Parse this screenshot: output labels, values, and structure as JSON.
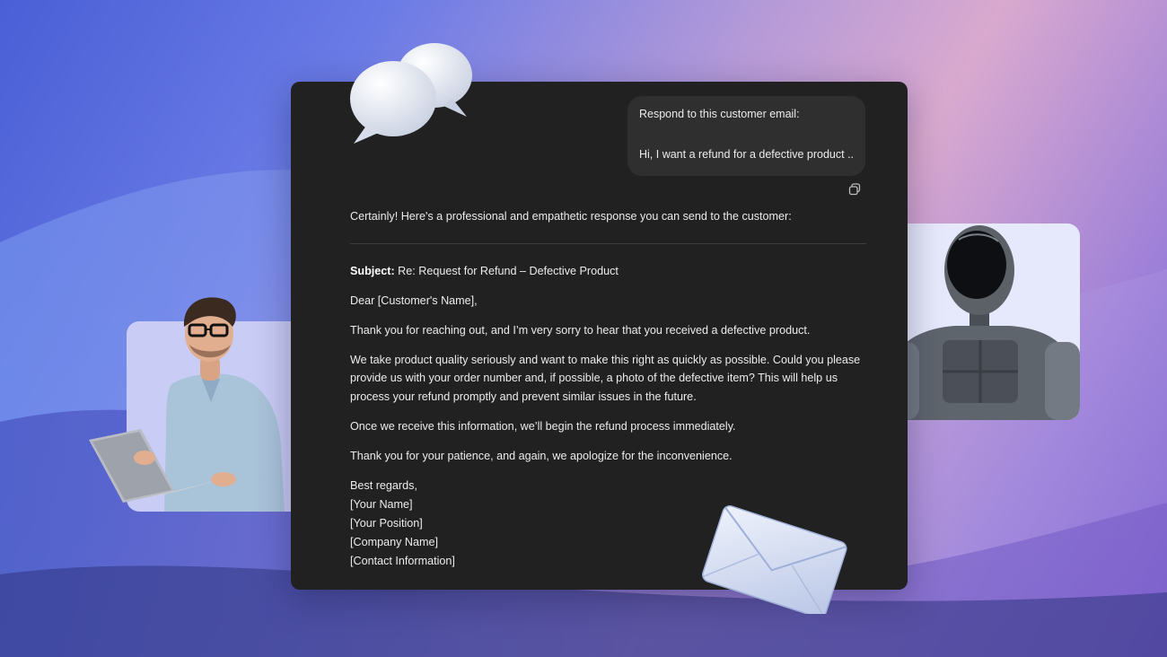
{
  "chat": {
    "user_message_line1": "Respond to this customer email:",
    "user_message_line2": "Hi, I want a refund for a defective product ...",
    "assistant_intro": "Certainly! Here's a professional and empathetic response you can send to the customer:",
    "subject_label": "Subject:",
    "subject_text": " Re: Request for Refund – Defective Product",
    "greeting": "Dear [Customer's Name],",
    "paragraph1": "Thank you for reaching out, and I’m very sorry to hear that you received a defective product.",
    "paragraph2": "We take product quality seriously and want to make this right as quickly as possible. Could you please provide us with your order number and, if possible, a photo of the defective item? This will help us process your refund promptly and prevent similar issues in the future.",
    "paragraph3": "Once we receive this information, we’ll begin the refund process immediately.",
    "paragraph4": "Thank you for your patience, and again, we apologize for the inconvenience.",
    "signoff": "Best regards,",
    "sig_name": "[Your Name]",
    "sig_position": "[Your Position]",
    "sig_company": "[Company Name]",
    "sig_contact": "[Contact Information]"
  },
  "icons": {
    "copy": "copy-icon",
    "bubbles": "speech-bubbles-icon",
    "envelope": "envelope-icon"
  },
  "colors": {
    "window_bg": "#212121",
    "bubble_bg": "#2f2f2f",
    "text": "#ececec"
  }
}
